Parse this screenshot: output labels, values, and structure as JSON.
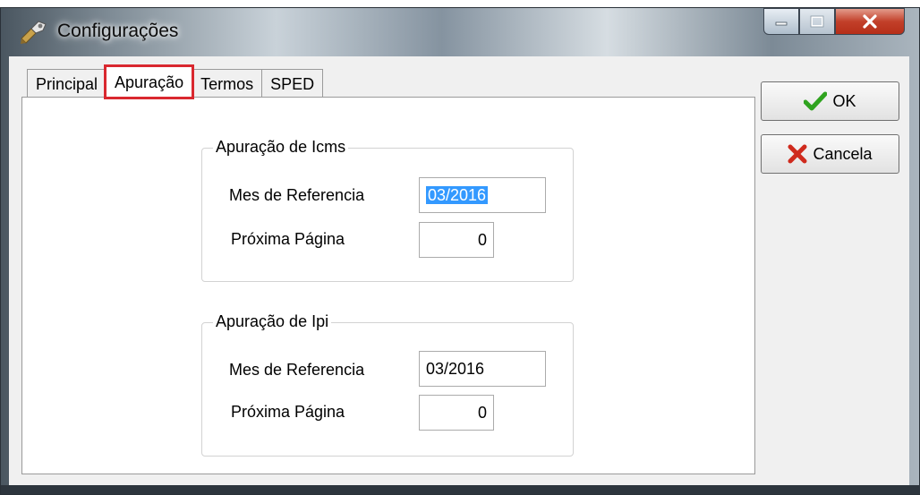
{
  "window": {
    "title": "Configurações",
    "controls": {
      "minimize": "minimize-icon",
      "maximize": "maximize-icon",
      "close": "close-icon"
    }
  },
  "tabs": [
    {
      "label": "Principal",
      "active": false
    },
    {
      "label": "Apuração",
      "active": true
    },
    {
      "label": "Termos",
      "active": false
    },
    {
      "label": "SPED",
      "active": false
    }
  ],
  "icms": {
    "legend": "Apuração de Icms",
    "mes_label": "Mes de Referencia",
    "mes_value": "03/2016",
    "pagina_label": "Próxima Página",
    "pagina_value": "0"
  },
  "ipi": {
    "legend": "Apuração de Ipi",
    "mes_label": "Mes de Referencia",
    "mes_value": "03/2016",
    "pagina_label": "Próxima Página",
    "pagina_value": "0"
  },
  "buttons": {
    "ok_label": "OK",
    "cancel_label": "Cancela"
  },
  "colors": {
    "highlight": "#d9282f",
    "selection": "#3399ff",
    "ok_check": "#2fa31f",
    "cancel_x": "#cf2a1d"
  }
}
